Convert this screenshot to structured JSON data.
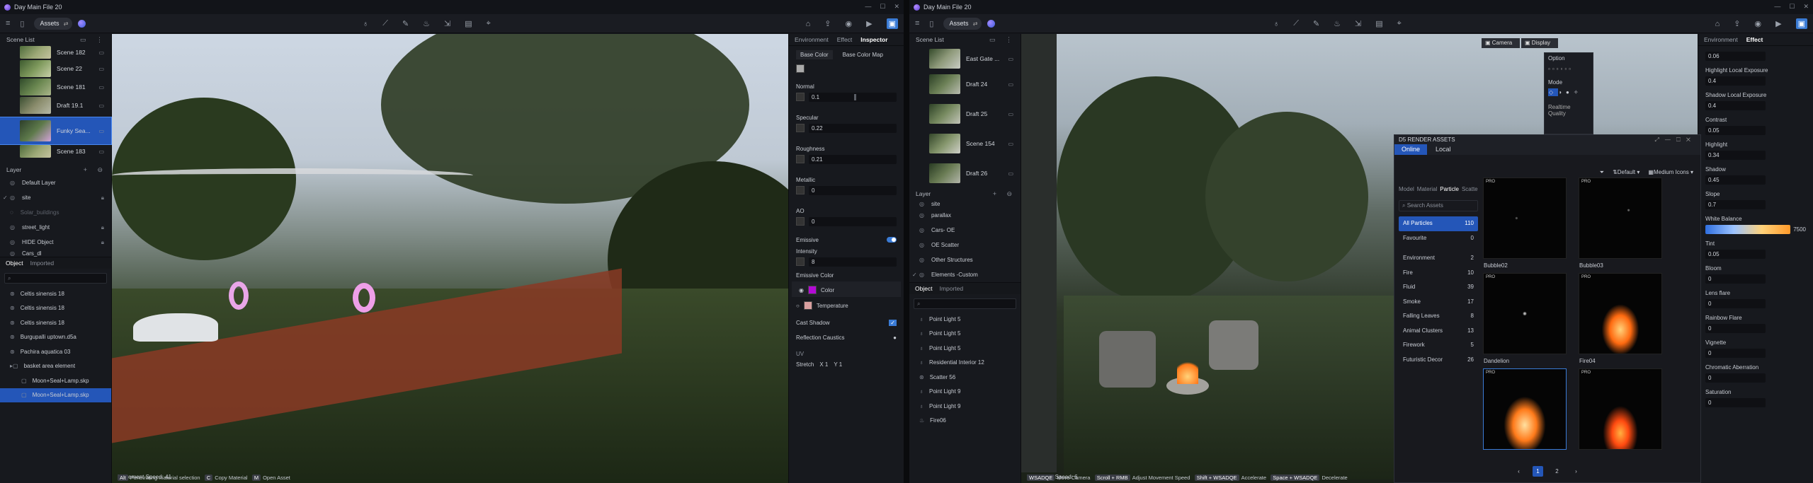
{
  "left": {
    "title": "Day Main File 20",
    "assets_label": "Assets",
    "scene_list_title": "Scene List",
    "scenes": [
      {
        "name": "Scene 182"
      },
      {
        "name": "Scene 22"
      },
      {
        "name": "Scene 181"
      },
      {
        "name": "Draft 19.1"
      },
      {
        "name": "Funky Sea..."
      },
      {
        "name": "Scene 183"
      }
    ],
    "layer_title": "Layer",
    "layers": [
      "Default Layer",
      "site",
      "Solar_buildings",
      "street_light",
      "HIDE Object",
      "Cars_dl"
    ],
    "object_tab": "Object",
    "imported_tab": "Imported",
    "objects": [
      "Celtis sinensis 18",
      "Celtis sinensis 18",
      "Celtis sinensis 18",
      "Burgupalli uptown.d5a",
      "Pachira aquatica 03",
      "basket area element",
      "Moon+Seal+Lamp.skp",
      "Moon+Seal+Lamp.skp"
    ],
    "tabs_right": [
      "Environment",
      "Effect",
      "Inspector"
    ],
    "base_color": "Base Color",
    "base_color_map": "Base Color Map",
    "normal": "Normal",
    "normal_val": "0.1",
    "specular": "Specular",
    "specular_val": "0.22",
    "roughness": "Roughness",
    "roughness_val": "0.21",
    "metallic": "Metallic",
    "metallic_val": "0",
    "ao": "AO",
    "ao_val": "0",
    "emissive": "Emissive",
    "intensity": "Intensity",
    "intensity_val": "8",
    "emissive_color": "Emissive Color",
    "color_opt": "Color",
    "temperature_opt": "Temperature",
    "cast_shadow": "Cast Shadow",
    "reflection_caustics": "Reflection Caustics",
    "uv": "UV",
    "stretch": "Stretch",
    "stretch_x": "1",
    "stretch_y": "1",
    "movement": "Movement Speed: 41",
    "hints": [
      {
        "key": "Alt",
        "text": "Penetrating material selection"
      },
      {
        "key": "C",
        "text": "Copy Material"
      },
      {
        "key": "M",
        "text": "Open Asset"
      }
    ],
    "emissive_swatch": "#b40ad6"
  },
  "right": {
    "title": "Day Main File 20",
    "assets_label": "Assets",
    "scene_list_title": "Scene List",
    "scenes": [
      {
        "name": "East Gate ..."
      },
      {
        "name": "Draft 24"
      },
      {
        "name": "Draft 25"
      },
      {
        "name": "Scene 154"
      },
      {
        "name": "Draft 26"
      }
    ],
    "layer_title": "Layer",
    "layers": [
      "site",
      "parallax",
      "Cars- OE",
      "OE Scatter",
      "Other Structures",
      "Elements -Custom"
    ],
    "object_tab": "Object",
    "imported_tab": "Imported",
    "objects": [
      "Point Light 5",
      "Point Light 5",
      "Point Light 5",
      "Residential Interior 12",
      "Scatter 56",
      "Point Light 9",
      "Point Light 9",
      "Fire06"
    ],
    "camera_btn": "Camera",
    "display_btn": "Display",
    "option_label": "Option",
    "mode_label": "Mode",
    "realtime_quality": "Realtime Quality",
    "tabs_right": [
      "Environment",
      "Effect"
    ],
    "effects": [
      {
        "label": "",
        "val": "0.06"
      },
      {
        "label": "Highlight Local Exposure",
        "val": "0.4"
      },
      {
        "label": "Shadow Local Exposure",
        "val": "0.4"
      },
      {
        "label": "Contrast",
        "val": "0.05"
      },
      {
        "label": "Highlight",
        "val": "0.34"
      },
      {
        "label": "Shadow",
        "val": "0.45"
      },
      {
        "label": "Slope",
        "val": "0.7"
      },
      {
        "label": "White Balance",
        "val": "7500"
      },
      {
        "label": "Tint",
        "val": "0.05"
      },
      {
        "label": "Bloom",
        "val": "0"
      },
      {
        "label": "Lens flare",
        "val": "0"
      },
      {
        "label": "Rainbow Flare",
        "val": "0"
      },
      {
        "label": "Vignette",
        "val": "0"
      },
      {
        "label": "Chromatic Aberration",
        "val": "0"
      },
      {
        "label": "Saturation",
        "val": "0"
      }
    ],
    "movement": "Movement Speed: 6",
    "hints": [
      {
        "key": "WSADQE",
        "text": "Move Camera"
      },
      {
        "key": "Scroll + RMB",
        "text": "Adjust Movement Speed"
      },
      {
        "key": "Shift + WSADQE",
        "text": "Accelerate"
      },
      {
        "key": "Space + WSADQE",
        "text": "Decelerate"
      }
    ],
    "asset_window": {
      "title": "D5 RENDER ASSETS",
      "tab_online": "Online",
      "tab_local": "Local",
      "filter_default": "Default",
      "filter_icons": "Medium Icons",
      "subtabs": [
        "Model",
        "Material",
        "Particle",
        "Scatte"
      ],
      "search_placeholder": "Search Assets",
      "categories": [
        {
          "name": "All Particles",
          "count": "110"
        },
        {
          "name": "Favourite",
          "count": "0"
        },
        {
          "name": "Environment",
          "count": "2"
        },
        {
          "name": "Fire",
          "count": "10"
        },
        {
          "name": "Fluid",
          "count": "39"
        },
        {
          "name": "Smoke",
          "count": "17"
        },
        {
          "name": "Falling Leaves",
          "count": "8"
        },
        {
          "name": "Animal Clusters",
          "count": "13"
        },
        {
          "name": "Firework",
          "count": "5"
        },
        {
          "name": "Futuristic Decor",
          "count": "26"
        }
      ],
      "items": [
        {
          "name": "Bubble02",
          "pro": "PRO"
        },
        {
          "name": "Bubble03",
          "pro": "PRO"
        },
        {
          "name": "Dandelion",
          "pro": "PRO"
        },
        {
          "name": "Fire04",
          "pro": "PRO"
        },
        {
          "name": "",
          "pro": "PRO"
        },
        {
          "name": "",
          "pro": "PRO"
        }
      ],
      "pages": [
        "1",
        "2"
      ]
    }
  }
}
